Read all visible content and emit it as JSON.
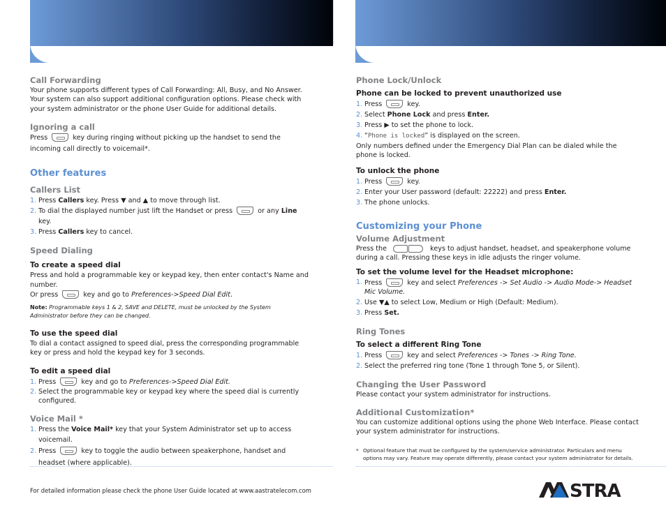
{
  "left": {
    "call_forwarding": {
      "title": "Call Forwarding",
      "body": "Your phone supports different types of Call Forwarding: All, Busy, and No Answer. Your system can also support additional configuration options. Please check with your system administrator or the phone User Guide for additional details."
    },
    "ignoring_call": {
      "title": "Ignoring a call",
      "pre": "Press",
      "key_icon": "voicemail-key",
      "post": "key during ringing without picking up the handset to send  the incoming call directly to voicemail*."
    },
    "other_features": {
      "title": "Other features"
    },
    "callers_list": {
      "title": "Callers List",
      "items": [
        {
          "num": "1.",
          "parts": [
            "Press ",
            "Callers",
            " key. Press ",
            "▼",
            " and ",
            "▲",
            " to move through list."
          ]
        },
        {
          "num": "2.",
          "parts": [
            "To dial the displayed number just lift the Handset or press ",
            "",
            " or any ",
            "Line",
            " key."
          ]
        },
        {
          "num": "3.",
          "parts": [
            "Press ",
            "Callers",
            " key to cancel."
          ]
        }
      ]
    },
    "speed_dialing": {
      "title": "Speed Dialing",
      "create": {
        "title": "To create a speed dial",
        "body": "Press and hold a programmable key or keypad key, then enter contact's Name and number.",
        "or_pre": "Or press",
        "or_mid": "key and go to",
        "or_path": "Preferences->Speed Dial Edit",
        "or_end": ".",
        "note_label": "Note:",
        "note_text": "Programmable keys 1 & 2, SAVE and DELETE, must be unlocked by the System Administrator before they can be changed."
      },
      "use": {
        "title": "To use the speed dial",
        "body": "To dial a contact assigned to speed dial, press the corresponding programmable key or press and hold the keypad key for 3 seconds."
      },
      "edit": {
        "title": "To edit a speed dial",
        "items": [
          {
            "num": "1.",
            "pre": "Press",
            "mid": "key and go to",
            "path": "Preferences->Speed Dial Edit."
          },
          {
            "num": "2.",
            "text": "Select the programmable key or  keypad key where the speed dial is currently configured."
          }
        ]
      }
    },
    "voice_mail": {
      "title": "Voice Mail *",
      "items": [
        {
          "num": "1.",
          "pre": "Press the ",
          "bold": "Voice Mail*",
          "post": " key that your System Administrator set up to access voicemail."
        },
        {
          "num": "2.",
          "pre": "Press",
          "post": "key to toggle the audio between speakerphone, handset and headset (where applicable)."
        }
      ]
    },
    "footer": "For detailed information please check the phone User Guide located at www.aastratelecom.com"
  },
  "right": {
    "phone_lock": {
      "title": "Phone Lock/Unlock",
      "lock_title": "Phone can be locked to prevent unauthorized use",
      "lock_items": [
        {
          "num": "1.",
          "pre": "Press",
          "post": "key."
        },
        {
          "num": "2.",
          "pre": "Select ",
          "bold1": "Phone Lock",
          "mid": " and press ",
          "bold2": "Enter."
        },
        {
          "num": "3.",
          "pre": "Press ",
          "glyph": "▶",
          "post": " to set the phone to lock."
        },
        {
          "num": "4.",
          "open": "“",
          "mono": "Phone is locked",
          "post": "” is displayed on the screen."
        }
      ],
      "lock_note": "Only numbers defined under the Emergency Dial Plan can be dialed while the phone is locked.",
      "unlock_title": "To unlock the phone",
      "unlock_items": [
        {
          "num": "1.",
          "pre": "Press",
          "post": "key."
        },
        {
          "num": "2.",
          "pre": "Enter your User password (default: 22222) and press ",
          "bold": "Enter."
        },
        {
          "num": "3.",
          "text": "The phone unlocks."
        }
      ]
    },
    "customizing": {
      "title": "Customizing your Phone"
    },
    "volume": {
      "title": "Volume Adjustment",
      "pre": "Press the",
      "post": "keys to adjust handset, headset, and speakerphone volume during a call. Pressing these keys in idle adjusts the ringer volume.",
      "headset_title": "To set the volume level for the Headset microphone:",
      "items": [
        {
          "num": "1.",
          "pre": "Press",
          "mid": "key and select",
          "path": "Preferences -> Set Audio -> Audio Mode-> Headset Mic Volume."
        },
        {
          "num": "2.",
          "pre": "Use ",
          "glyph": "▼▲",
          "post": " to select Low, Medium or High (Default: Medium)."
        },
        {
          "num": "3.",
          "pre": "Press ",
          "bold": "Set."
        }
      ]
    },
    "ring_tones": {
      "title": "Ring Tones",
      "sub_title": "To select a different Ring Tone",
      "items": [
        {
          "num": "1.",
          "pre": "Press",
          "mid": "key and select",
          "path": "Preferences -> Tones -> Ring Tone."
        },
        {
          "num": "2.",
          "text": "Select the preferred ring tone (Tone 1 through Tone 5, or Silent)."
        }
      ]
    },
    "password": {
      "title": "Changing the User Password",
      "body": "Please contact your system administrator for instructions."
    },
    "additional": {
      "title": "Additional Customization*",
      "body": "You can customize additional options using the phone Web Interface. Please contact your system administrator for instructions."
    },
    "footnote": {
      "star": "*",
      "text": "Optional feature that must be configured by the system/service administrator. Particulars and menu options may vary. Feature may operate differently, please contact your system administrator for details."
    },
    "logo": {
      "text": "AASTRA",
      "color": "#231f20",
      "accent": "#1e6fc2"
    }
  },
  "colors": {
    "heading_blue": "#5b8fd1",
    "subheading_gray": "#808285",
    "banner_start": "#6d9bd8",
    "banner_end": "#000308"
  }
}
